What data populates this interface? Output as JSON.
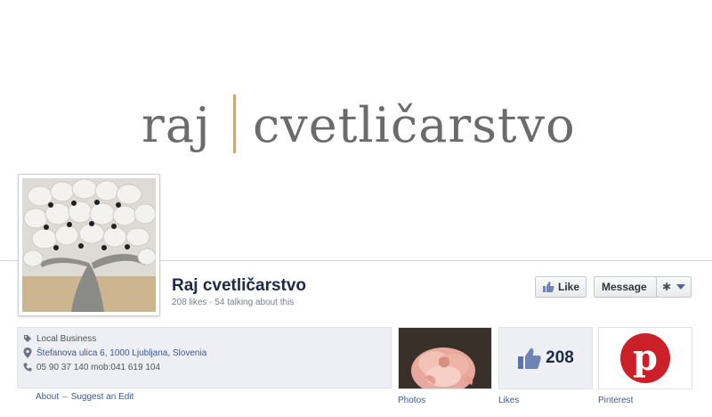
{
  "cover": {
    "logo_left": "raj",
    "logo_right": "cvetličarstvo"
  },
  "page": {
    "name": "Raj cvetličarstvo",
    "stats": "208 likes · 54 talking about this"
  },
  "actions": {
    "like_label": "Like",
    "message_label": "Message",
    "gear_glyph": "✱"
  },
  "info": {
    "category": "Local Business",
    "address": "Štefanova ulica 6, 1000 Ljubljana, Slovenia",
    "phone": "05 90 37 140 mob:041 619 104",
    "about_link": "About",
    "separator": "–",
    "suggest_link": "Suggest an Edit"
  },
  "apps": [
    {
      "label": "Photos"
    },
    {
      "label": "Likes",
      "count": "208"
    },
    {
      "label": "Pinterest",
      "glyph": "p"
    }
  ],
  "colors": {
    "brand_blue": "#3b5998",
    "pinterest_red": "#cb2027",
    "logo_gray": "#6b6b6b",
    "logo_bar": "#c8a977"
  },
  "icons": {
    "category": "tag-icon",
    "address": "map-pin-icon",
    "phone": "phone-icon",
    "like": "thumbs-up-icon",
    "gear": "gear-icon",
    "caret": "chevron-down-icon"
  }
}
